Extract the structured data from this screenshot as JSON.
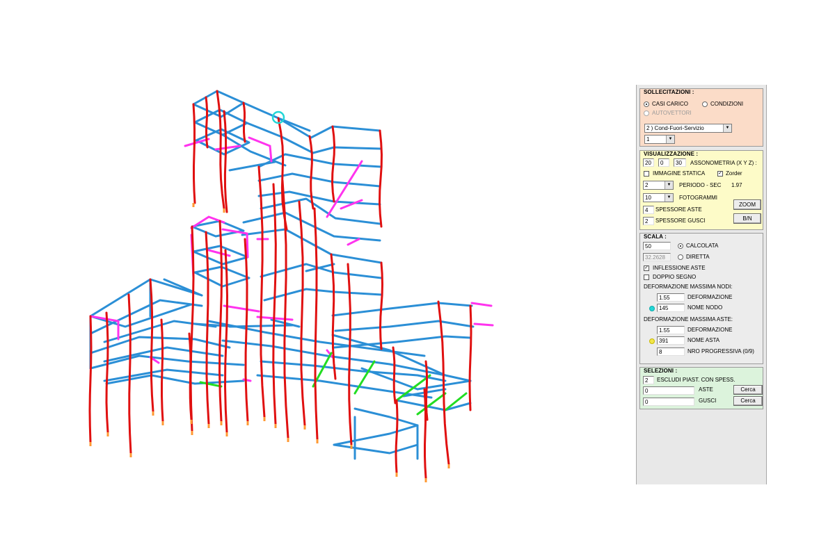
{
  "sollecitazioni": {
    "title": "SOLLECITAZIONI :",
    "casi_carico": "CASI CARICO",
    "condizioni": "CONDIZIONI",
    "autovettori": "AUTOVETTORI",
    "combo_case": "2 ) Cond-Fuori-Servizio",
    "combo_sub": "1"
  },
  "visualizzazione": {
    "title": "VISUALIZZAZIONE :",
    "axo_x": "20",
    "axo_y": "0",
    "axo_z": "30",
    "axo_label": "ASSONOMETRIA (X Y Z) :",
    "immagine_statica": "IMMAGINE STATICA",
    "zorder": "Zorder",
    "periodo_value": "2",
    "periodo_label": "PERIODO - SEC",
    "periodo_sec": "1.97",
    "fotogrammi_value": "10",
    "fotogrammi_label": "FOTOGRAMMI",
    "spessore_aste_value": "4",
    "spessore_aste_label": "SPESSORE ASTE",
    "spessore_gusci_value": "2",
    "spessore_gusci_label": "SPESSORE GUSCI",
    "zoom": "ZOOM",
    "bn": "B/N"
  },
  "scala": {
    "title": "SCALA :",
    "scale_value": "50",
    "calcolata": "CALCOLATA",
    "direct_value": "32.2628",
    "diretta": "DIRETTA",
    "inflessione": "INFLESSIONE ASTE",
    "doppio": "DOPPIO SEGNO",
    "def_nodi_title": "DEFORMAZIONE MASSIMA NODI:",
    "nodi_def_value": "1.55",
    "nodi_def_label": "DEFORMAZIONE",
    "nodi_name_value": "145",
    "nodi_name_label": "NOME NODO",
    "def_aste_title": "DEFORMAZIONE MASSIMA ASTE:",
    "aste_def_value": "1.55",
    "aste_def_label": "DEFORMAZIONE",
    "aste_name_value": "391",
    "aste_name_label": "NOME ASTA",
    "prog_value": "8",
    "prog_label": "NRO PROGRESSIVA (0/9)"
  },
  "selezioni": {
    "title": "SELEZIONI :",
    "escludi_value": "2",
    "escludi_label": "ESCLUDI PIAST. CON SPESS.",
    "aste_value": "0",
    "aste_label": "ASTE",
    "gusci_value": "0",
    "gusci_label": "GUSCI",
    "cerca1": "Cerca",
    "cerca2": "Cerca"
  },
  "colors": {
    "beam": "#2b8fd6",
    "column": "#e01010",
    "deformed": "#ff33ee",
    "slab_edge": "#22dd22",
    "base": "#ff9933",
    "marker": "#22d6d6",
    "sollecitazioni_bg": "#fbdcc8",
    "visualizzazione_bg": "#fdfbc8",
    "selezioni_bg": "#dcf3dc"
  }
}
